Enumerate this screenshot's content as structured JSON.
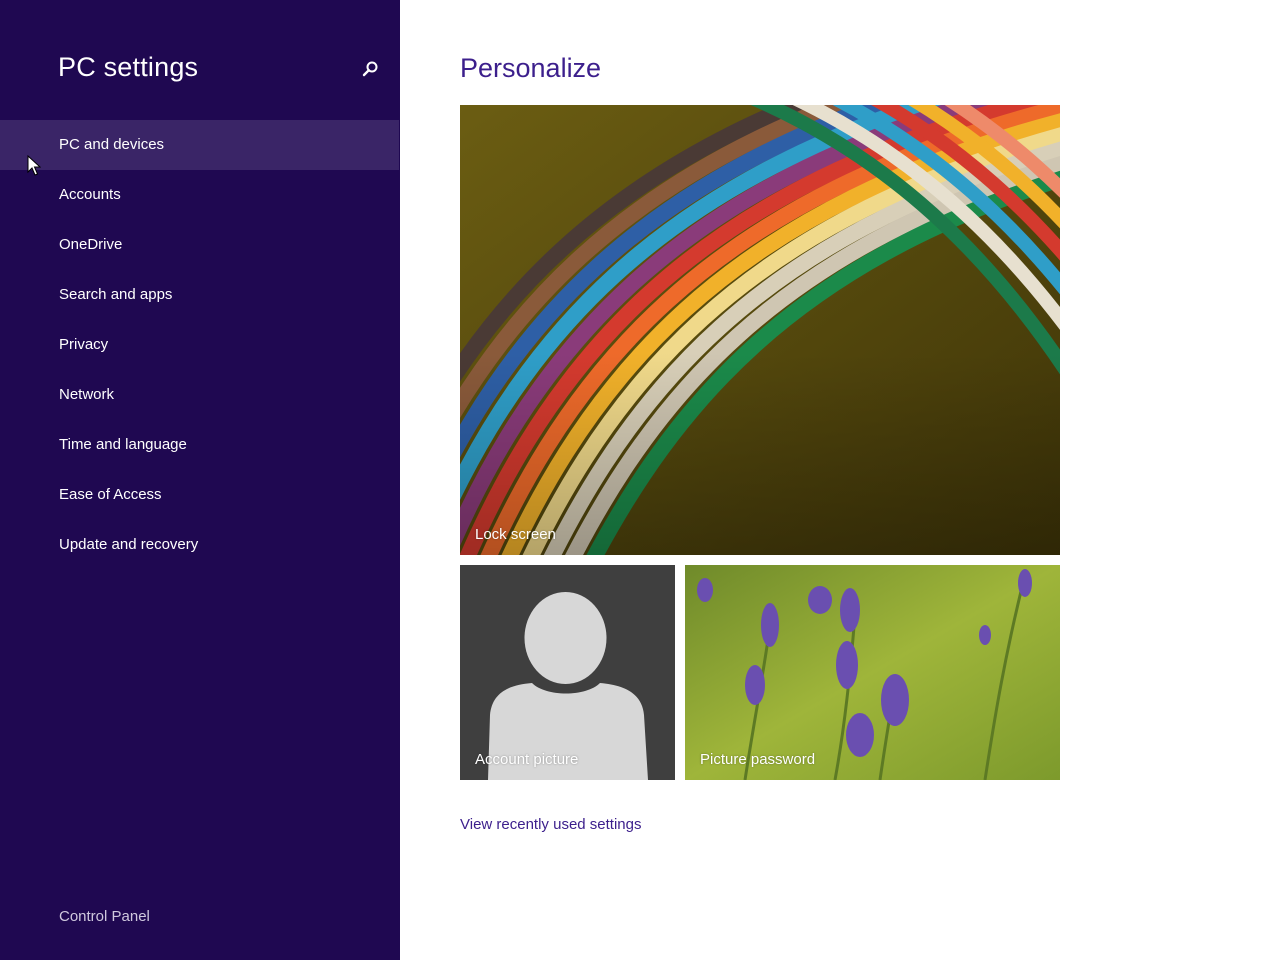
{
  "sidebar": {
    "title": "PC settings",
    "search_icon": "search-icon",
    "items": [
      {
        "label": "PC and devices",
        "selected": true
      },
      {
        "label": "Accounts",
        "selected": false
      },
      {
        "label": "OneDrive",
        "selected": false
      },
      {
        "label": "Search and apps",
        "selected": false
      },
      {
        "label": "Privacy",
        "selected": false
      },
      {
        "label": "Network",
        "selected": false
      },
      {
        "label": "Time and language",
        "selected": false
      },
      {
        "label": "Ease of Access",
        "selected": false
      },
      {
        "label": "Update and recovery",
        "selected": false
      }
    ],
    "footer_link": "Control Panel"
  },
  "main": {
    "title": "Personalize",
    "tiles": {
      "lock_screen": "Lock screen",
      "account_picture": "Account picture",
      "picture_password": "Picture password"
    },
    "recent_link": "View recently used settings"
  },
  "colors": {
    "sidebar_bg": "#1f0851",
    "selected_bg": "#3a2567",
    "accent": "#3c1f8c",
    "account_tile_bg": "#3f3f3f"
  }
}
